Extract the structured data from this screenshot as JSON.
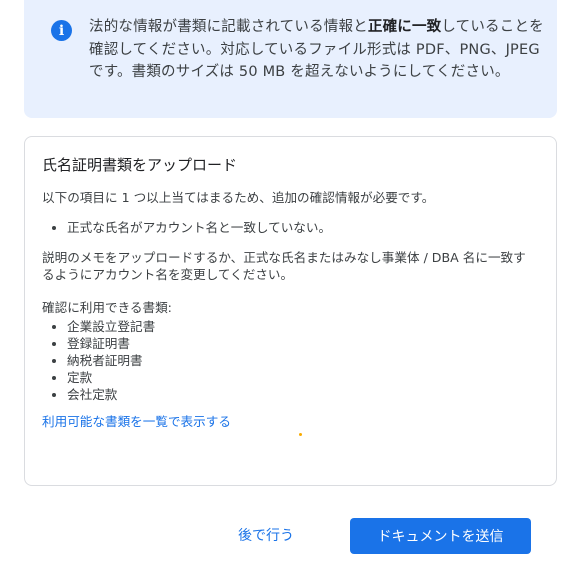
{
  "info_banner": {
    "icon": "info-icon",
    "text_before": "法的な情報が書類に記載されている情報と",
    "text_bold": "正確に一致",
    "text_after": "していることを確認してください。対応しているファイル形式は PDF、PNG、JPEG です。書類のサイズは 50 MB を超えないようにしてください。"
  },
  "card": {
    "title": "氏名証明書類をアップロード",
    "intro": "以下の項目に 1 つ以上当てはまるため、追加の確認情報が必要です。",
    "reasons": [
      "正式な氏名がアカウント名と一致していない。"
    ],
    "instruction": "説明のメモをアップロードするか、正式な氏名またはみなし事業体 / DBA 名に一致するようにアカウント名を変更してください。",
    "documents_heading": "確認に利用できる書類:",
    "documents": [
      "企業設立登記書",
      "登録証明書",
      "納税者証明書",
      "定款",
      "会社定款"
    ],
    "view_all_link": "利用可能な書類を一覧で表示する"
  },
  "actions": {
    "later_label": "後で行う",
    "submit_label": "ドキュメントを送信"
  },
  "colors": {
    "accent": "#1a73e8",
    "banner_bg": "#e8f0fe",
    "border": "#dadce0"
  }
}
